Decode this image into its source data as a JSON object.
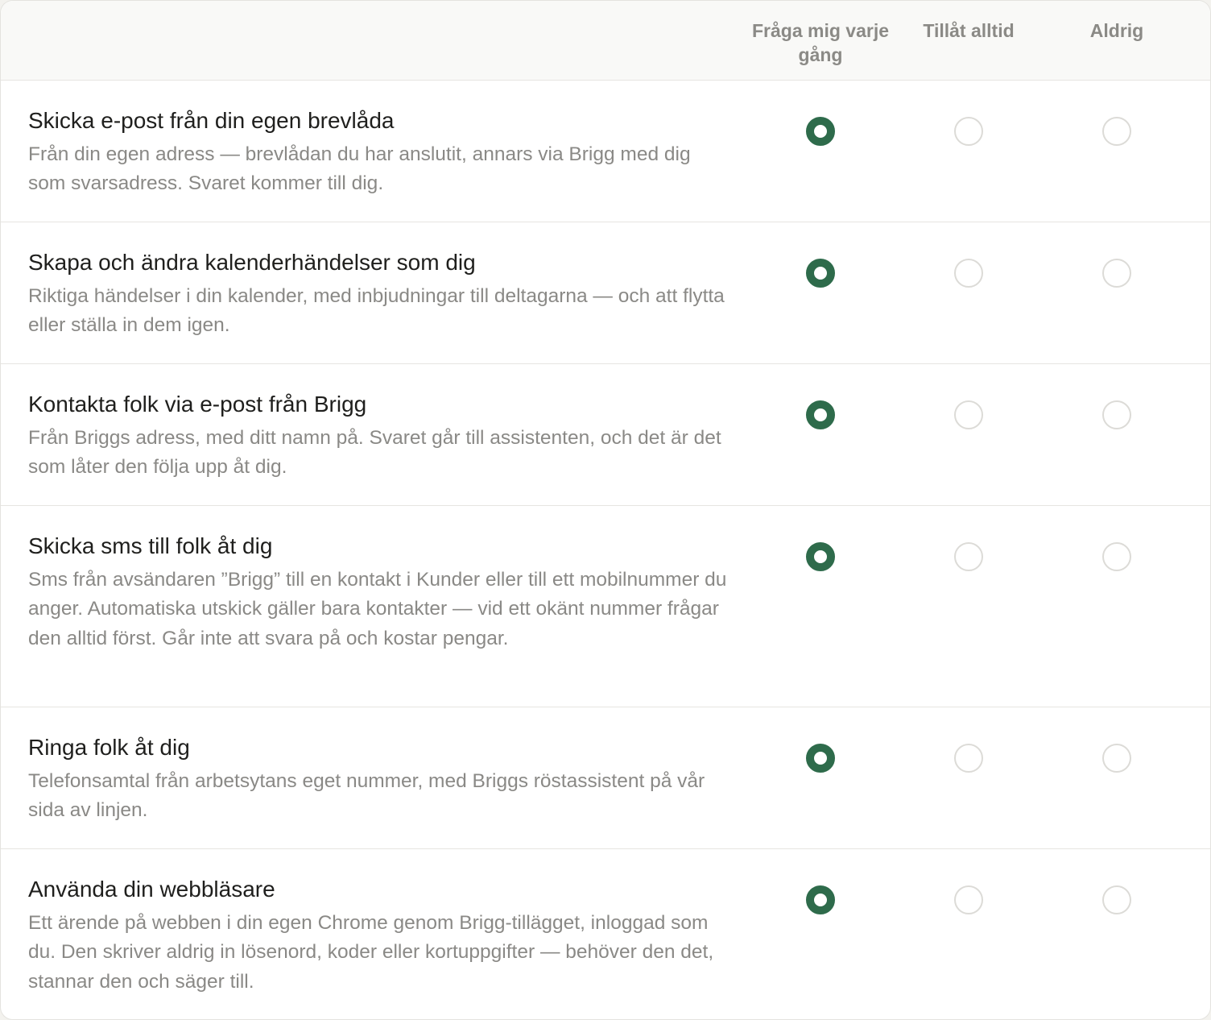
{
  "columns": [
    "Fråga mig varje gång",
    "Tillåt alltid",
    "Aldrig"
  ],
  "accent_color": "#2e6b4b",
  "rows": [
    {
      "title": "Skicka e-post från din egen brevlåda",
      "description": "Från din egen adress — brevlådan du har anslutit, annars via Brigg med dig som svarsadress. Svaret kommer till dig.",
      "selected": 0
    },
    {
      "title": "Skapa och ändra kalenderhändelser som dig",
      "description": "Riktiga händelser i din kalender, med inbjudningar till deltagarna — och att flytta eller ställa in dem igen.",
      "selected": 0
    },
    {
      "title": "Kontakta folk via e-post från Brigg",
      "description": "Från Briggs adress, med ditt namn på. Svaret går till assistenten, och det är det som låter den följa upp åt dig.",
      "selected": 0
    },
    {
      "title": "Skicka sms till folk åt dig",
      "description": "Sms från avsändaren ”Brigg” till en kontakt i Kunder eller till ett mobilnummer du anger. Automatiska utskick gäller bara kontakter — vid ett okänt nummer frågar den alltid först. Går inte att svara på och kostar pengar.",
      "selected": 0
    },
    {
      "title": "Ringa folk åt dig",
      "description": "Telefonsamtal från arbetsytans eget nummer, med Briggs röstassistent på vår sida av linjen.",
      "selected": 0
    },
    {
      "title": "Använda din webbläsare",
      "description": "Ett ärende på webben i din egen Chrome genom Brigg-tillägget, inloggad som du. Den skriver aldrig in lösenord, koder eller kortuppgifter — behöver den det, stannar den och säger till.",
      "selected": 0
    }
  ]
}
